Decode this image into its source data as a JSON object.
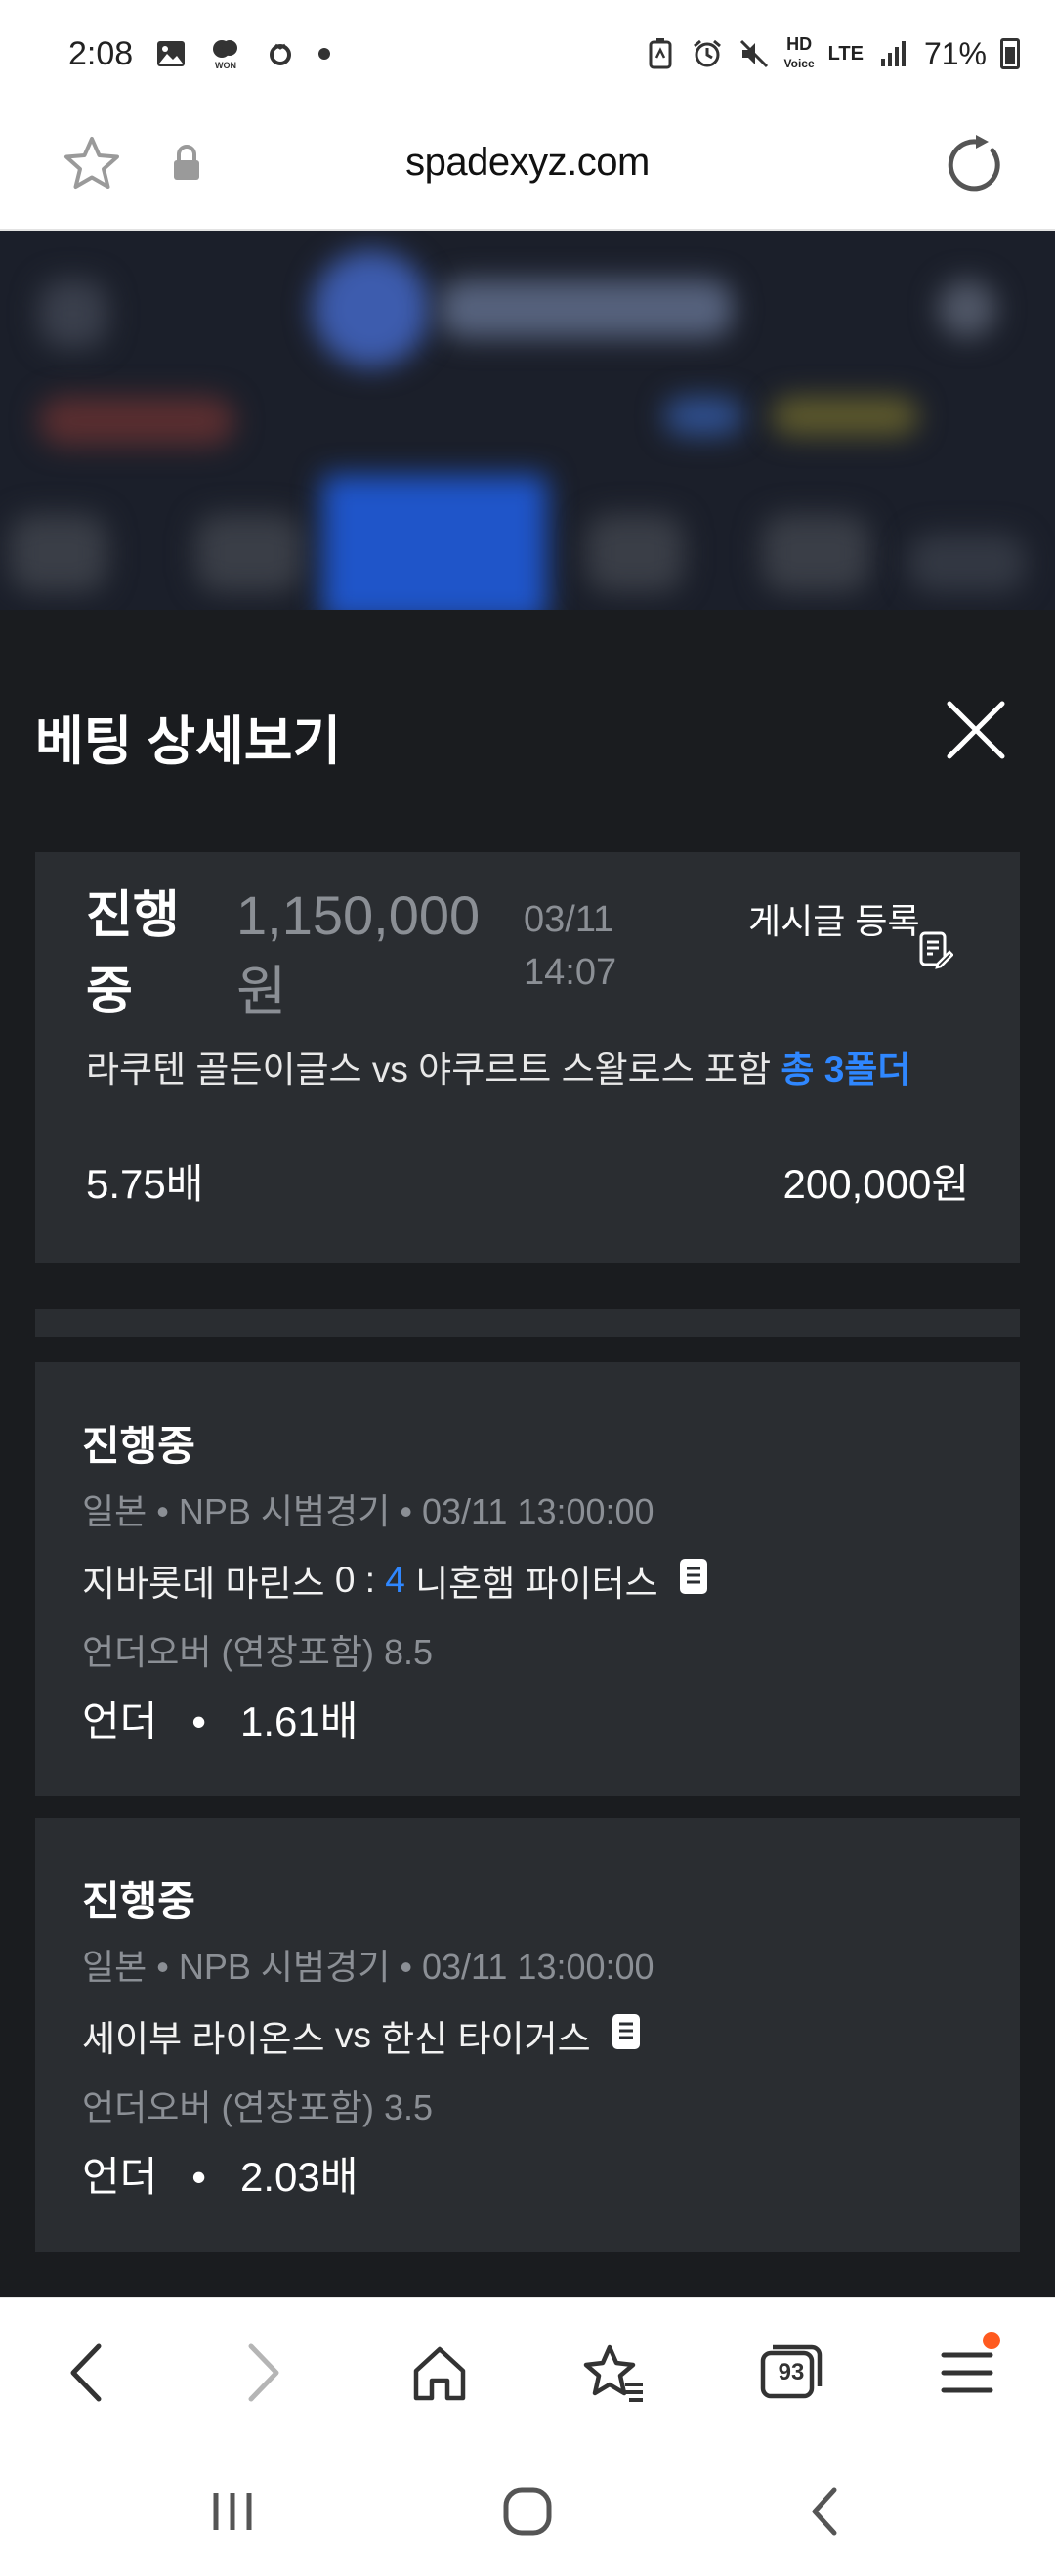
{
  "status_bar": {
    "time": "2:08",
    "network": "LTE",
    "battery": "71%",
    "hd_label": "HD",
    "voice_label": "Voice"
  },
  "browser": {
    "url": "spadexyz.com"
  },
  "modal": {
    "title": "베팅 상세보기",
    "summary": {
      "status": "진행중",
      "amount": "1,150,000원",
      "date": "03/11 14:07",
      "post_label": "게시글 등록",
      "match_text": "라쿠텐 골든이글스 vs 야쿠르트 스왈로스 포함",
      "fold_text": "총 3폴더",
      "odds": "5.75배",
      "stake": "200,000원"
    },
    "bets": [
      {
        "status": "진행중",
        "country": "일본",
        "league": "NPB 시범경기",
        "datetime": "03/11 13:00:00",
        "home": "지바롯데 마린스",
        "home_score": "0",
        "separator": ":",
        "away_score": "4",
        "away": "니혼햄 파이터스",
        "market": "언더오버 (연장포함) 8.5",
        "pick": "언더",
        "pick_odds": "1.61배"
      },
      {
        "status": "진행중",
        "country": "일본",
        "league": "NPB 시범경기",
        "datetime": "03/11 13:00:00",
        "home": "세이부 라이온스",
        "vs": "vs",
        "away": "한신 타이거스",
        "market": "언더오버 (연장포함) 3.5",
        "pick": "언더",
        "pick_odds": "2.03배"
      }
    ]
  },
  "bottom_nav": {
    "tab_count": "93"
  },
  "colors": {
    "accent_blue": "#2f87ff",
    "modal_bg": "#1a1c1f",
    "card_bg": "#2a2d31",
    "muted_text": "#8b8f95",
    "notification": "#ff5a1f"
  },
  "icons": {
    "status_left": [
      "gallery-icon",
      "won-icon",
      "tomato-icon"
    ],
    "status_right": [
      "battery-saver-icon",
      "alarm-icon",
      "mute-icon",
      "signal-icon",
      "battery-icon"
    ],
    "browser": [
      "star-icon",
      "lock-icon",
      "reload-icon"
    ],
    "bottom_nav": [
      "back-icon",
      "forward-icon",
      "home-icon",
      "bookmarks-icon",
      "tabs-icon",
      "menu-icon"
    ],
    "system_nav": [
      "recents-icon",
      "home-circle-icon",
      "system-back-icon"
    ]
  }
}
